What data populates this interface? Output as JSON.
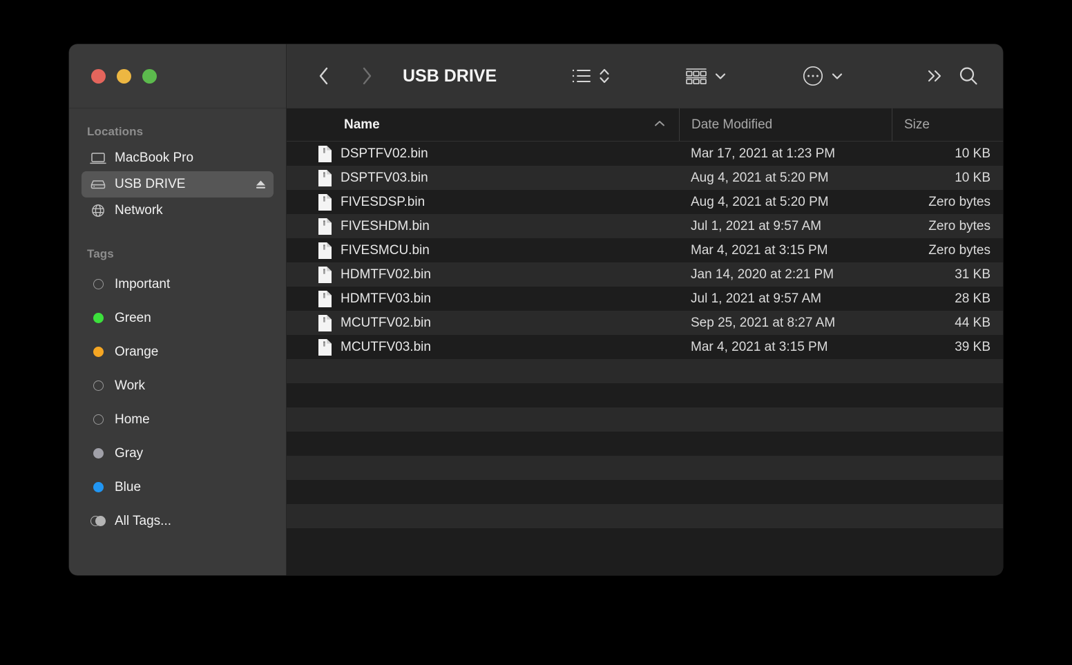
{
  "window": {
    "title": "USB DRIVE",
    "traffic_lights": [
      {
        "name": "close",
        "color": "#e4655c"
      },
      {
        "name": "minimize",
        "color": "#edb742"
      },
      {
        "name": "maximize",
        "color": "#5cba4d"
      }
    ]
  },
  "toolbar": {
    "back_icon": "chevron-left-icon",
    "forward_icon": "chevron-right-icon",
    "title": "USB DRIVE",
    "view_icon": "list-view-icon",
    "view_sort_icon": "chevron-up-down-icon",
    "group_icon": "group-by-icon",
    "group_chevron": "chevron-down-icon",
    "actions_icon": "more-actions-icon",
    "actions_chevron": "chevron-down-icon",
    "overflow_icon": "double-chevron-right-icon",
    "search_icon": "search-icon"
  },
  "sidebar": {
    "locations_title": "Locations",
    "locations": [
      {
        "label": "MacBook Pro",
        "icon": "laptop-icon",
        "selected": false,
        "eject": false
      },
      {
        "label": "USB DRIVE",
        "icon": "drive-icon",
        "selected": true,
        "eject": true
      },
      {
        "label": "Network",
        "icon": "globe-icon",
        "selected": false,
        "eject": false
      }
    ],
    "tags_title": "Tags",
    "tags": [
      {
        "label": "Important",
        "color": "none"
      },
      {
        "label": "Green",
        "color": "#3ce03c"
      },
      {
        "label": "Orange",
        "color": "#f5a623"
      },
      {
        "label": "Work",
        "color": "none"
      },
      {
        "label": "Home",
        "color": "none"
      },
      {
        "label": "Gray",
        "color": "#a0a0a8"
      },
      {
        "label": "Blue",
        "color": "#2196f3"
      }
    ],
    "all_tags_label": "All Tags...",
    "all_tags_icon": "all-tags-icon"
  },
  "columns": {
    "name": "Name",
    "date_modified": "Date Modified",
    "size": "Size",
    "sort_caret": "▲"
  },
  "files": [
    {
      "name": "DSPTFV02.bin",
      "date": "Mar 17, 2021 at 1:23 PM",
      "size": "10 KB"
    },
    {
      "name": "DSPTFV03.bin",
      "date": "Aug 4, 2021 at 5:20 PM",
      "size": "10 KB"
    },
    {
      "name": "FIVESDSP.bin",
      "date": "Aug 4, 2021 at 5:20 PM",
      "size": "Zero bytes"
    },
    {
      "name": "FIVESHDM.bin",
      "date": "Jul 1, 2021 at 9:57 AM",
      "size": "Zero bytes"
    },
    {
      "name": "FIVESMCU.bin",
      "date": "Mar 4, 2021 at 3:15 PM",
      "size": "Zero bytes"
    },
    {
      "name": "HDMTFV02.bin",
      "date": "Jan 14, 2020 at 2:21 PM",
      "size": "31 KB"
    },
    {
      "name": "HDMTFV03.bin",
      "date": "Jul 1, 2021 at 9:57 AM",
      "size": "28 KB"
    },
    {
      "name": "MCUTFV02.bin",
      "date": "Sep 25, 2021 at 8:27 AM",
      "size": "44 KB"
    },
    {
      "name": "MCUTFV03.bin",
      "date": "Mar 4, 2021 at 3:15 PM",
      "size": "39 KB"
    }
  ]
}
